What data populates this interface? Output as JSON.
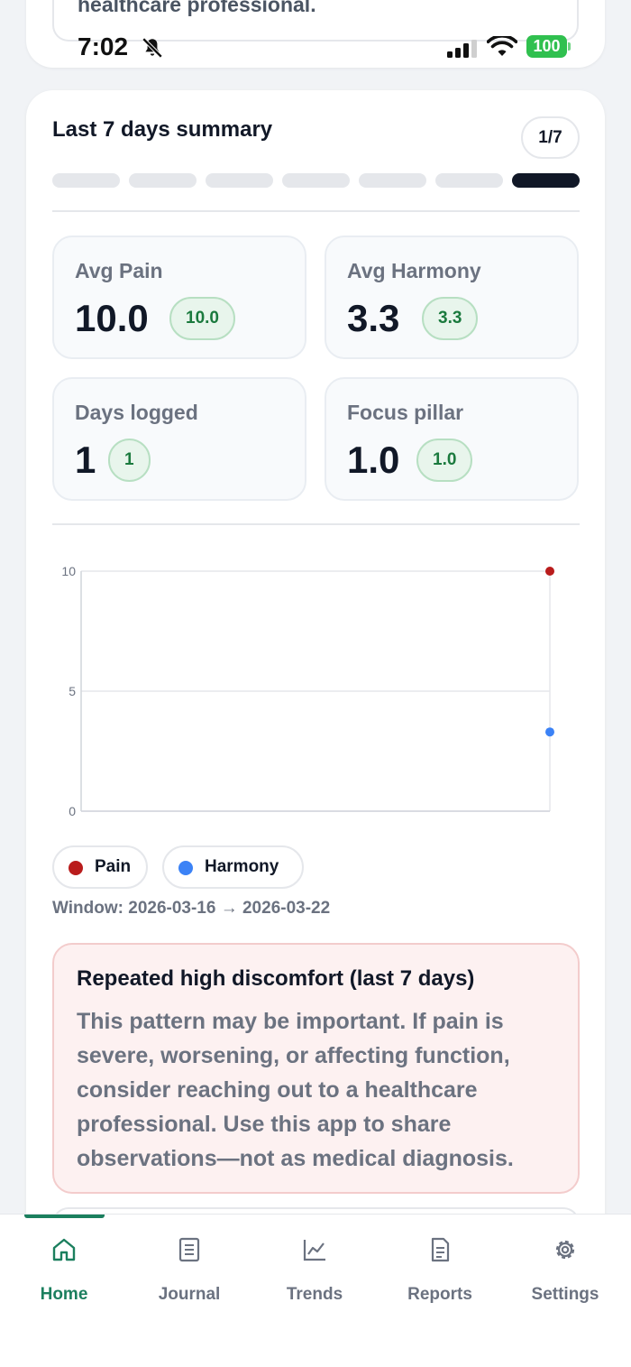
{
  "top_card": {
    "partial_text": "healthcare professional."
  },
  "status_bar": {
    "time": "7:02",
    "battery": "100"
  },
  "summary": {
    "title": "Last 7 days summary",
    "step": "1/7",
    "progress_total": 7,
    "progress_active": 7
  },
  "stats": [
    {
      "label": "Avg Pain",
      "value": "10.0",
      "badge": "10.0"
    },
    {
      "label": "Avg Harmony",
      "value": "3.3",
      "badge": "3.3"
    },
    {
      "label": "Days logged",
      "value": "1",
      "badge": "1"
    },
    {
      "label": "Focus pillar",
      "value": "1.0",
      "badge": "1.0"
    }
  ],
  "chart_data": {
    "type": "scatter",
    "title": "",
    "xlabel": "",
    "ylabel": "",
    "ylim": [
      0,
      10
    ],
    "yticks": [
      "0",
      "5",
      "10"
    ],
    "grid": true,
    "x_positions": 7,
    "series": [
      {
        "name": "Pain",
        "color": "#b91c1c",
        "points": [
          {
            "x": 7,
            "y": 10.0
          }
        ]
      },
      {
        "name": "Harmony",
        "color": "#3b82f6",
        "points": [
          {
            "x": 7,
            "y": 3.3
          }
        ]
      }
    ]
  },
  "legend": [
    {
      "label": "Pain",
      "color": "#b91c1c"
    },
    {
      "label": "Harmony",
      "color": "#3b82f6"
    }
  ],
  "window_text": "Window: 2026-03-16 → 2026-03-22",
  "alert": {
    "title": "Repeated high discomfort (last 7 days)",
    "body": "This pattern may be important. If pain is severe, worsening, or affecting function, consider reaching out to a healthcare professional. Use this app to share observations—not as medical diagnosis."
  },
  "tabs": [
    {
      "label": "Home",
      "icon": "home-icon",
      "active": true
    },
    {
      "label": "Journal",
      "icon": "journal-icon",
      "active": false
    },
    {
      "label": "Trends",
      "icon": "trends-icon",
      "active": false
    },
    {
      "label": "Reports",
      "icon": "reports-icon",
      "active": false
    },
    {
      "label": "Settings",
      "icon": "settings-icon",
      "active": false
    }
  ],
  "colors": {
    "accent": "#1b7f5e",
    "pain": "#b91c1c",
    "harmony": "#3b82f6"
  }
}
